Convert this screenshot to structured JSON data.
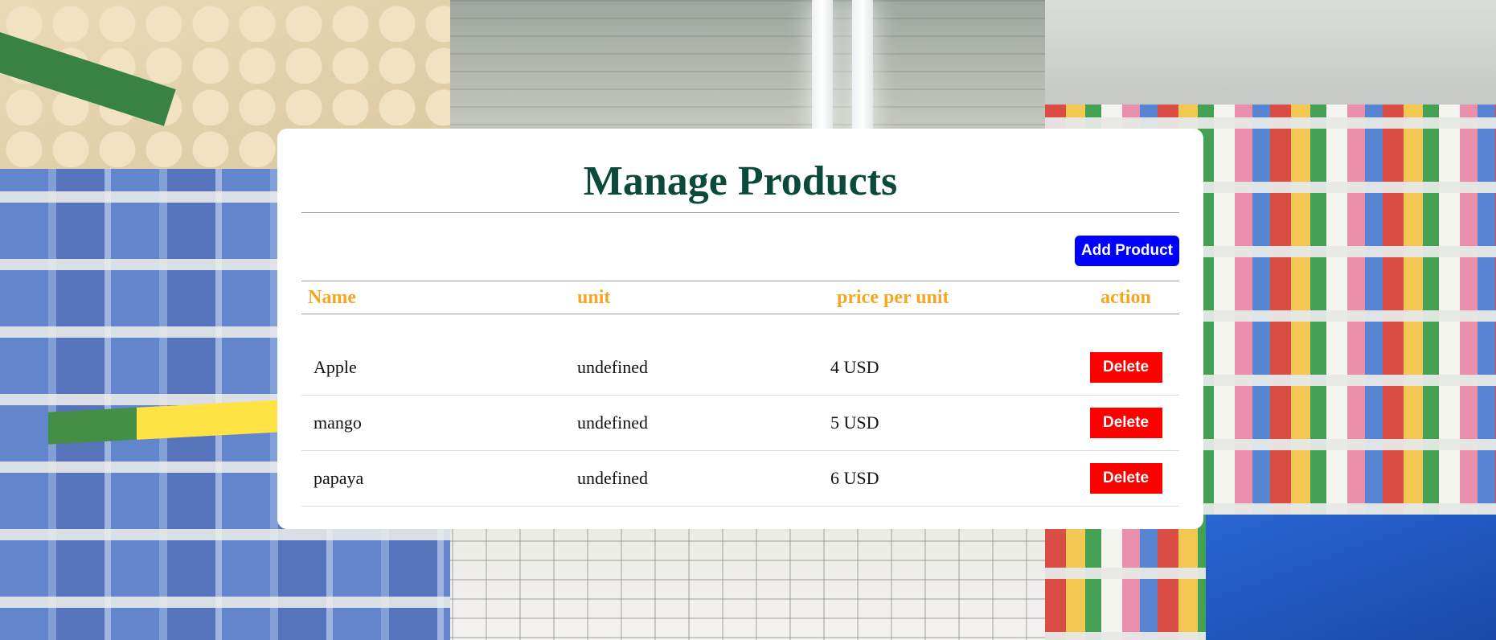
{
  "page": {
    "title": "Manage Products"
  },
  "toolbar": {
    "add_label": "Add Product"
  },
  "table": {
    "columns": [
      "Name",
      "unit",
      "price per unit",
      "action"
    ],
    "rows": [
      {
        "name": "Apple",
        "unit": "undefined",
        "price": "4 USD",
        "action": "Delete"
      },
      {
        "name": "mango",
        "unit": "undefined",
        "price": "5 USD",
        "action": "Delete"
      },
      {
        "name": "papaya",
        "unit": "undefined",
        "price": "6 USD",
        "action": "Delete"
      }
    ]
  },
  "colors": {
    "title": "#0b4a3a",
    "header_text": "#f5a623",
    "add_button": "#0000ff",
    "delete_button": "#ff0000"
  },
  "background": {
    "description_icon": "supermarket-aisle-image"
  }
}
